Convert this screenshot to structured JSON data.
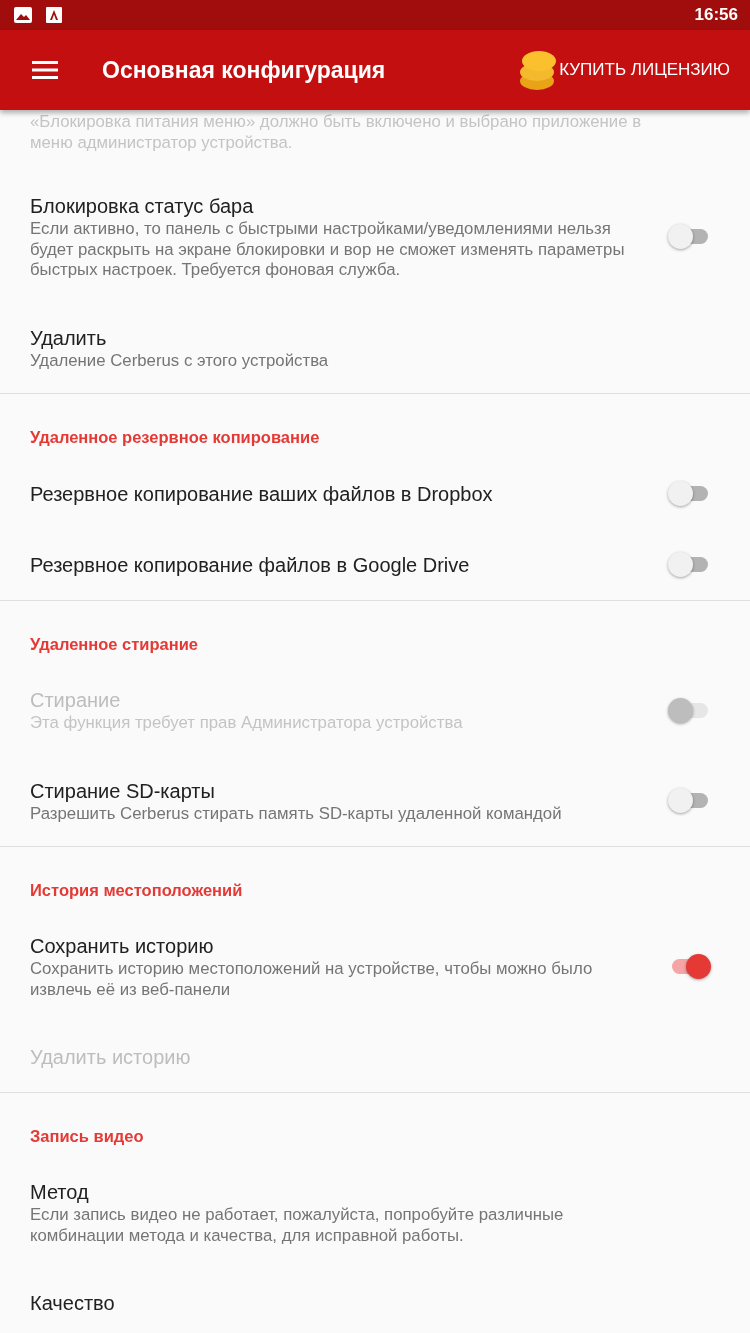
{
  "status_bar": {
    "time": "16:56"
  },
  "app_bar": {
    "title": "Основная конфигурация",
    "action": "КУПИТЬ ЛИЦЕНЗИЮ"
  },
  "sections": [
    {
      "items": [
        {
          "kind": "text",
          "summary": "«Блокировка питания меню» должно быть включено и выбрано приложение в меню администратор устройства.",
          "disabled": true
        },
        {
          "kind": "switch",
          "title": "Блокировка статус бара",
          "summary": "Если активно, то панель с быстрыми настройками/уведомлениями нельзя будет раскрыть на экране блокировки и вор не сможет изменять параметры быстрых настроек. Требуется фоновая служба.",
          "on": false,
          "disabled": false
        },
        {
          "kind": "text",
          "title": "Удалить",
          "summary": "Удаление Cerberus с этого устройства",
          "disabled": false
        }
      ]
    },
    {
      "header": "Удаленное резервное копирование",
      "items": [
        {
          "kind": "switch",
          "title": "Резервное копирование ваших файлов в Dropbox",
          "on": false,
          "disabled": false
        },
        {
          "kind": "switch",
          "title": "Резервное копирование файлов в Google Drive",
          "on": false,
          "disabled": false
        }
      ]
    },
    {
      "header": "Удаленное стирание",
      "items": [
        {
          "kind": "switch",
          "title": "Стирание",
          "summary": "Эта функция требует прав Администратора устройства",
          "on": false,
          "disabled": true
        },
        {
          "kind": "switch",
          "title": "Стирание SD-карты",
          "summary": "Разрешить Cerberus стирать память SD-карты удаленной командой",
          "on": false,
          "disabled": false
        }
      ]
    },
    {
      "header": "История местоположений",
      "items": [
        {
          "kind": "switch",
          "title": "Сохранить историю",
          "summary": "Сохранить историю местоположений на устройстве, чтобы можно было извлечь её из веб-панели",
          "on": true,
          "disabled": false
        },
        {
          "kind": "text",
          "title": "Удалить историю",
          "disabled": true
        }
      ]
    },
    {
      "header": "Запись видео",
      "items": [
        {
          "kind": "text",
          "title": "Метод",
          "summary": "Если запись видео не работает, пожалуйста, попробуйте различные комбинации метода и качества, для исправной работы.",
          "disabled": false
        },
        {
          "kind": "text",
          "title": "Качество",
          "disabled": false
        }
      ]
    }
  ]
}
